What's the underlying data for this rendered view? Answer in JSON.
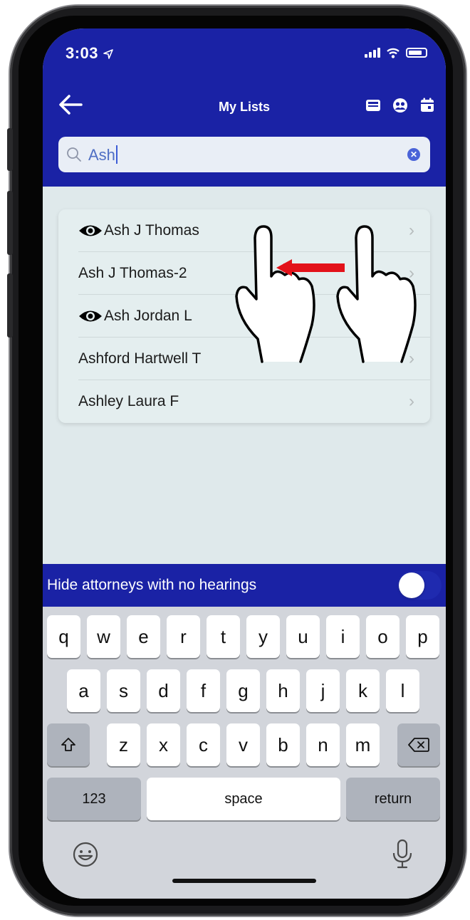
{
  "status_bar": {
    "time": "3:03"
  },
  "header": {
    "title": "My Lists"
  },
  "search": {
    "value": "Ash"
  },
  "list": {
    "items": [
      {
        "label": "Ash J Thomas",
        "watched": true
      },
      {
        "label": "Ash J Thomas-2",
        "watched": false
      },
      {
        "label": "Ash Jordan L",
        "watched": true
      },
      {
        "label": "Ashford Hartwell T",
        "watched": false
      },
      {
        "label": "Ashley Laura F",
        "watched": false
      }
    ]
  },
  "toggle": {
    "label": "Hide attorneys with no hearings",
    "on": false
  },
  "keyboard": {
    "row1": [
      "q",
      "w",
      "e",
      "r",
      "t",
      "y",
      "u",
      "i",
      "o",
      "p"
    ],
    "row2": [
      "a",
      "s",
      "d",
      "f",
      "g",
      "h",
      "j",
      "k",
      "l"
    ],
    "row3": [
      "z",
      "x",
      "c",
      "v",
      "b",
      "n",
      "m"
    ],
    "numbers_label": "123",
    "space_label": "space",
    "return_label": "return"
  },
  "colors": {
    "brand": "#1a22a5",
    "background": "#dfe9eb",
    "gesture_arrow": "#e3121a"
  }
}
